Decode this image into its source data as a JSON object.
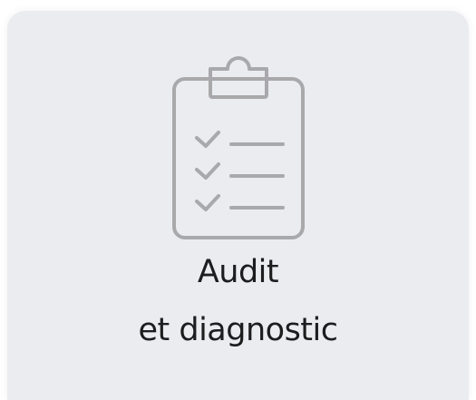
{
  "tile": {
    "title_line1": "Audit",
    "title_line2": "et diagnostic",
    "icon": "clipboard-checklist-icon",
    "background_color": "#ebecf0",
    "icon_color": "#a9a9ab",
    "text_color": "#1d1d1f"
  }
}
